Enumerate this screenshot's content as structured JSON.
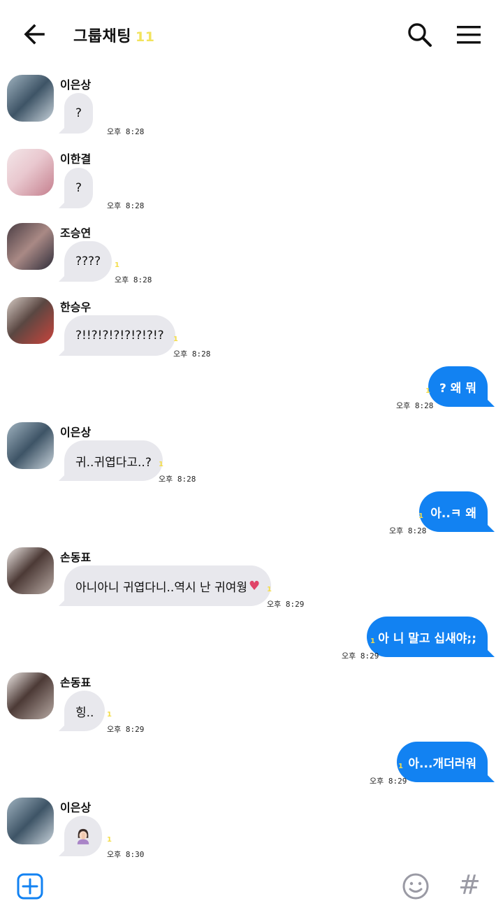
{
  "header": {
    "title": "그룹채팅",
    "member_count": "11",
    "icons": {
      "back": "back-arrow-icon",
      "search": "search-icon",
      "menu": "hamburger-menu-icon"
    }
  },
  "messages": [
    {
      "sender": "이은상",
      "text": "?",
      "time": "오후 8:28",
      "unread": ""
    },
    {
      "sender": "이한결",
      "text": "?",
      "time": "오후 8:28",
      "unread": ""
    },
    {
      "sender": "조승연",
      "text": "????",
      "time": "오후 8:28",
      "unread": "1"
    },
    {
      "sender": "한승우",
      "text": "?!!?!?!?!?!?!?!?",
      "time": "오후 8:28",
      "unread": "1"
    },
    {
      "sender": "me",
      "text": "? 왜 뭐",
      "time": "오후 8:28",
      "unread": "1"
    },
    {
      "sender": "이은상",
      "text": "귀..귀엽다고..?",
      "time": "오후 8:28",
      "unread": "1"
    },
    {
      "sender": "me",
      "text": "아..ㅋ 왜",
      "time": "오후 8:28",
      "unread": "1"
    },
    {
      "sender": "손동표",
      "text": "아니아니 귀엽다니..역시 난 귀여웡",
      "time": "오후 8:29",
      "unread": "1",
      "emoji": "heart-emoji"
    },
    {
      "sender": "me",
      "text": "아 니 말고 십새야;;",
      "time": "오후 8:29",
      "unread": "1"
    },
    {
      "sender": "손동표",
      "text": "힝..",
      "time": "오후 8:29",
      "unread": "1"
    },
    {
      "sender": "me",
      "text": "아...개더러워",
      "time": "오후 8:29",
      "unread": "1"
    },
    {
      "sender": "이은상",
      "text": "",
      "time": "오후 8:30",
      "unread": "1",
      "emoji": "person-facepalm-emoji"
    }
  ],
  "bottom_bar": {
    "icons": {
      "plus": "plus-box-icon",
      "emoji": "smiley-icon",
      "hash": "hash-icon"
    },
    "hash_glyph": "#"
  },
  "colors": {
    "accent": "#1282f2",
    "incoming_bubble": "#e8e8ed",
    "unread": "#f4dd4a"
  }
}
